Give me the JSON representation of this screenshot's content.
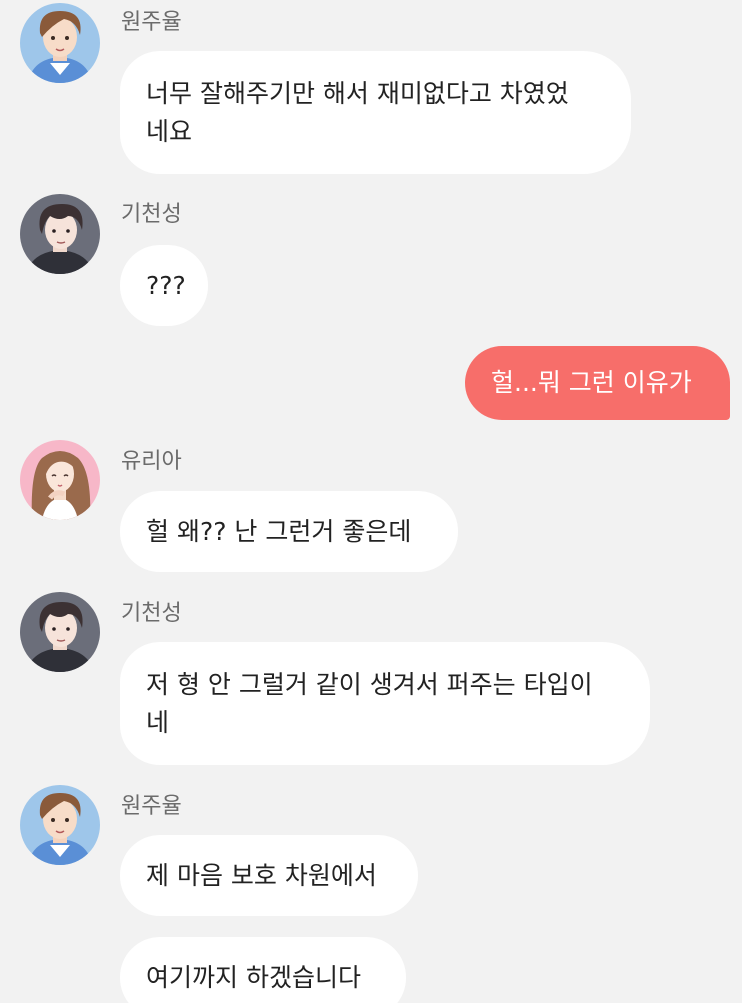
{
  "theme": {
    "background": "#f2f2f2",
    "incoming_bubble": "#ffffff",
    "outgoing_bubble": "#f76e6a",
    "sender_name_color": "#6b6b6b"
  },
  "messages": [
    {
      "sender": "원주율",
      "text": "너무 잘해주기만 해서 재미없다고 차였었\n네요",
      "avatar_icon": "avatar-wonjuyul-icon"
    },
    {
      "sender": "기천성",
      "text": "???",
      "avatar_icon": "avatar-gicheonseong-icon"
    },
    {
      "sender": "",
      "text": "헐...뭐 그런 이유가",
      "outgoing": true
    },
    {
      "sender": "유리아",
      "text": "헐 왜?? 난 그런거 좋은데",
      "avatar_icon": "avatar-yuria-icon"
    },
    {
      "sender": "기천성",
      "text": "저 형 안 그럴거 같이 생겨서 퍼주는 타입이\n네",
      "avatar_icon": "avatar-gicheonseong-icon"
    },
    {
      "sender": "원주율",
      "text": "제 마음 보호 차원에서",
      "avatar_icon": "avatar-wonjuyul-icon"
    },
    {
      "sender": "",
      "text": "여기까지 하겠습니다"
    }
  ]
}
